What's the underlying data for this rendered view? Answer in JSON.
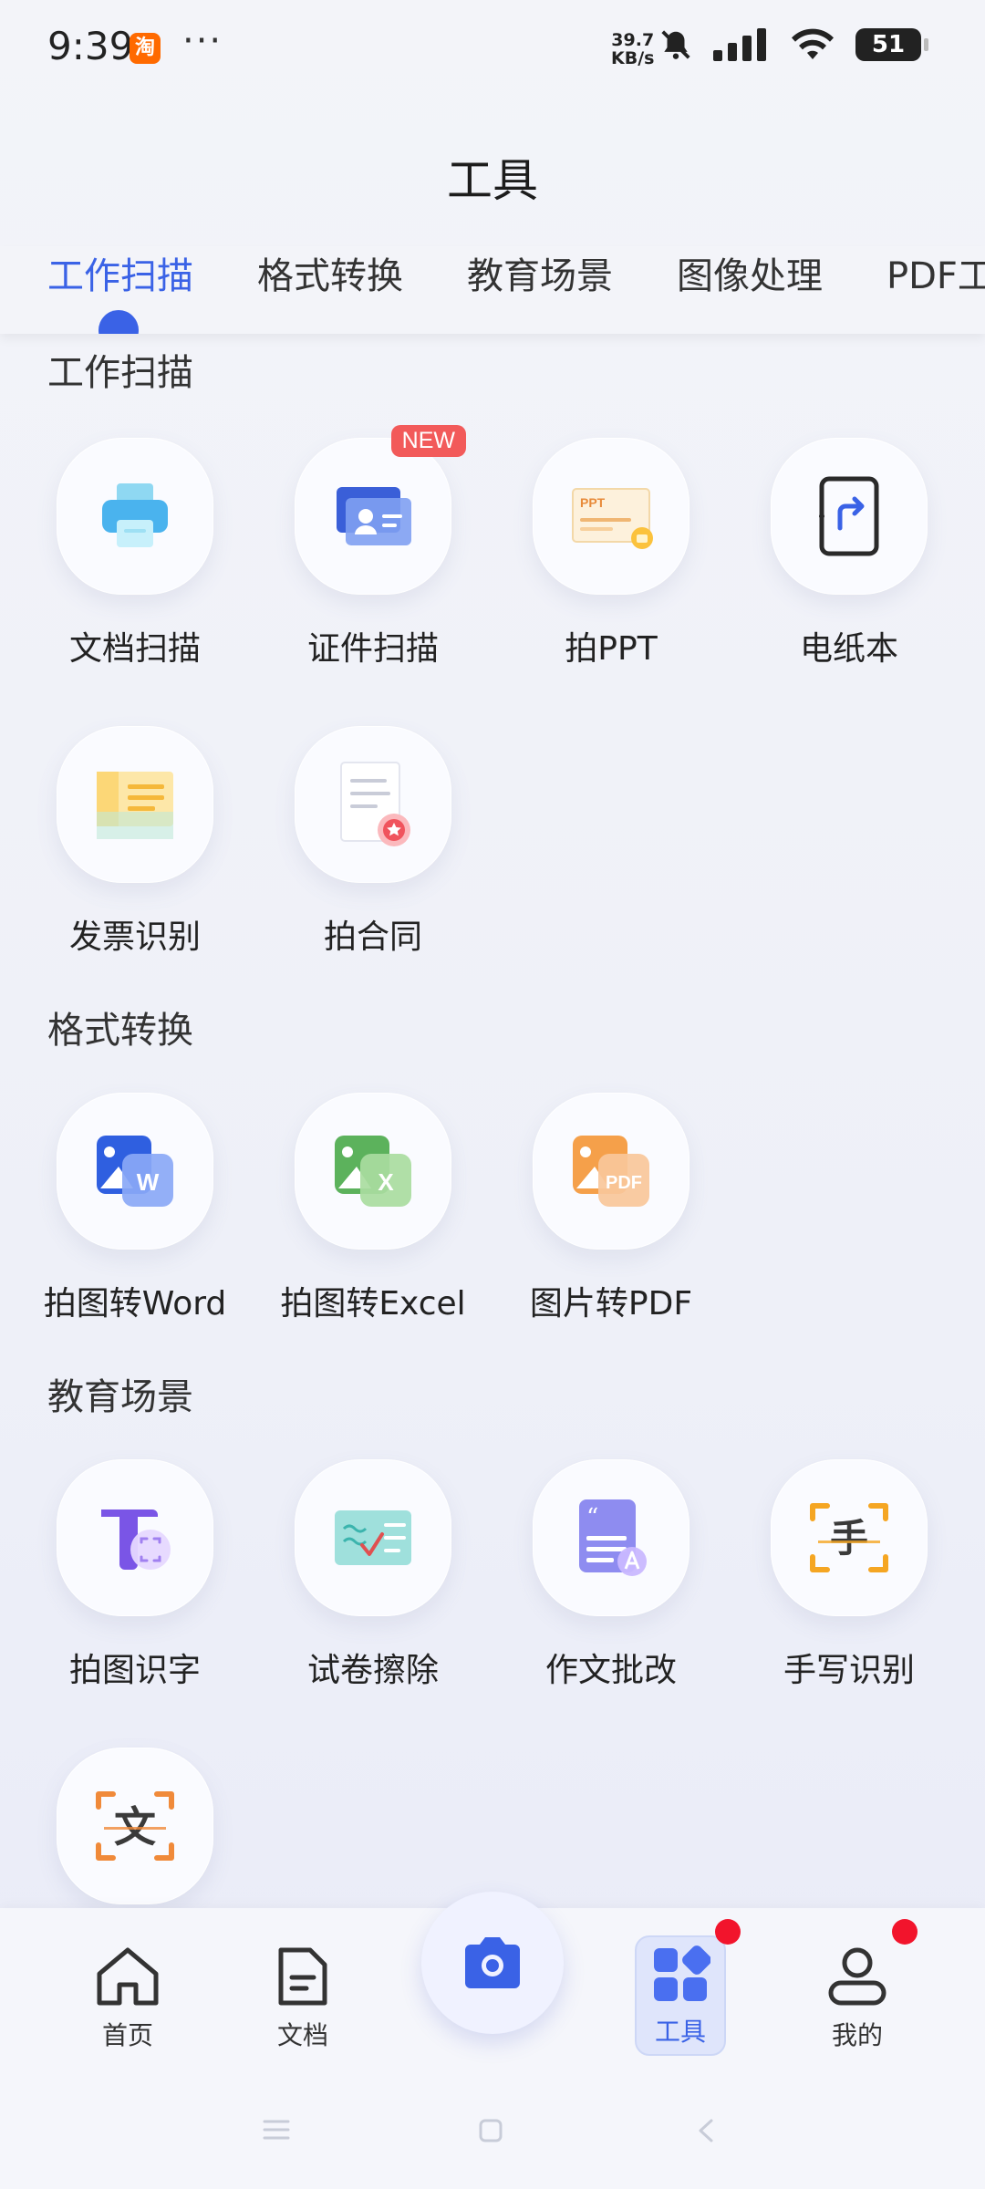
{
  "status_bar": {
    "time": "9:39",
    "app_badge": "淘",
    "more": "···",
    "net_speed_value": "39.7",
    "net_speed_unit": "KB/s",
    "battery": "51",
    "icons": [
      "bell-muted-icon",
      "signal-icon",
      "wifi-icon",
      "battery-icon"
    ]
  },
  "page": {
    "title": "工具"
  },
  "tabs": [
    {
      "label": "工作扫描",
      "active": true
    },
    {
      "label": "格式转换",
      "active": false
    },
    {
      "label": "教育场景",
      "active": false
    },
    {
      "label": "图像处理",
      "active": false
    },
    {
      "label": "PDF工",
      "active": false
    }
  ],
  "sections": {
    "work_scan": {
      "title": "工作扫描",
      "tools": [
        {
          "label": "文档扫描",
          "icon": "printer-icon",
          "badge": ""
        },
        {
          "label": "证件扫描",
          "icon": "id-card-icon",
          "badge": "NEW"
        },
        {
          "label": "拍PPT",
          "icon": "ppt-icon",
          "badge": ""
        },
        {
          "label": "电纸本",
          "icon": "tablet-icon",
          "badge": ""
        },
        {
          "label": "发票识别",
          "icon": "invoice-icon",
          "badge": ""
        },
        {
          "label": "拍合同",
          "icon": "contract-icon",
          "badge": ""
        }
      ]
    },
    "format_convert": {
      "title": "格式转换",
      "tools": [
        {
          "label": "拍图转Word",
          "icon": "word-icon",
          "icon_text": "W"
        },
        {
          "label": "拍图转Excel",
          "icon": "excel-icon",
          "icon_text": "X"
        },
        {
          "label": "图片转PDF",
          "icon": "pdf-icon",
          "icon_text": "PDF"
        }
      ]
    },
    "education": {
      "title": "教育场景",
      "tools": [
        {
          "label": "拍图识字",
          "icon": "text-recognition-icon"
        },
        {
          "label": "试卷擦除",
          "icon": "exam-erase-icon"
        },
        {
          "label": "作文批改",
          "icon": "essay-correction-icon"
        },
        {
          "label": "手写识别",
          "icon": "handwriting-icon",
          "icon_text": "手"
        },
        {
          "label": "",
          "icon": "translate-icon",
          "icon_text": "文"
        }
      ]
    }
  },
  "ppt_icon_text": "PPT",
  "bottom_nav": [
    {
      "label": "首页",
      "icon": "home-icon",
      "active": false
    },
    {
      "label": "文档",
      "icon": "document-icon",
      "active": false
    },
    {
      "label": "",
      "icon": "camera-icon",
      "active": false
    },
    {
      "label": "工具",
      "icon": "tools-grid-icon",
      "active": true
    },
    {
      "label": "我的",
      "icon": "user-icon",
      "active": false
    }
  ],
  "colors": {
    "accent": "#3a62e6",
    "badge_red": "#f25a5a",
    "dot_red": "#f2142c"
  }
}
